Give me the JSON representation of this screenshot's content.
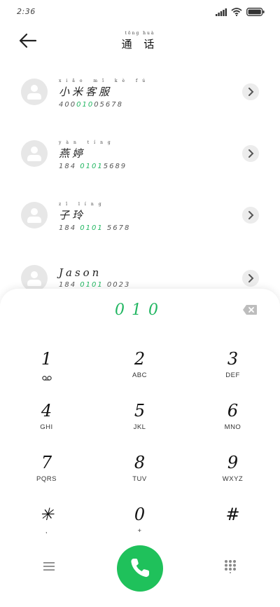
{
  "status_bar": {
    "time": "2:36"
  },
  "header": {
    "title_pinyin": "tōng huà",
    "title": "通 话"
  },
  "contacts": [
    {
      "pinyin": "xiǎo mǐ kè fú",
      "name": "小米客服",
      "number_pre": "400",
      "number_hl": "010",
      "number_post": "05678"
    },
    {
      "pinyin": "yàn tíng",
      "name": "燕婷",
      "number_pre": "184 ",
      "number_hl": "0101",
      "number_post": "5689"
    },
    {
      "pinyin": "zǐ líng",
      "name": "子玲",
      "number_pre": "184 ",
      "number_hl": "0101",
      "number_post": " 5678"
    },
    {
      "pinyin": "",
      "name": "Jason",
      "number_pre": "184 ",
      "number_hl": "0101",
      "number_post": " 0023"
    }
  ],
  "dialer": {
    "entry": "010",
    "keys": [
      {
        "digit": "1",
        "letters": ""
      },
      {
        "digit": "2",
        "letters": "ABC"
      },
      {
        "digit": "3",
        "letters": "DEF"
      },
      {
        "digit": "4",
        "letters": "GHI"
      },
      {
        "digit": "5",
        "letters": "JKL"
      },
      {
        "digit": "6",
        "letters": "MNO"
      },
      {
        "digit": "7",
        "letters": "PQRS"
      },
      {
        "digit": "8",
        "letters": "TUV"
      },
      {
        "digit": "9",
        "letters": "WXYZ"
      },
      {
        "digit": "✳",
        "letters": ","
      },
      {
        "digit": "0",
        "letters": "+"
      },
      {
        "digit": "#",
        "letters": ""
      }
    ]
  },
  "colors": {
    "accent": "#21b661",
    "call_button": "#1fc15b"
  }
}
